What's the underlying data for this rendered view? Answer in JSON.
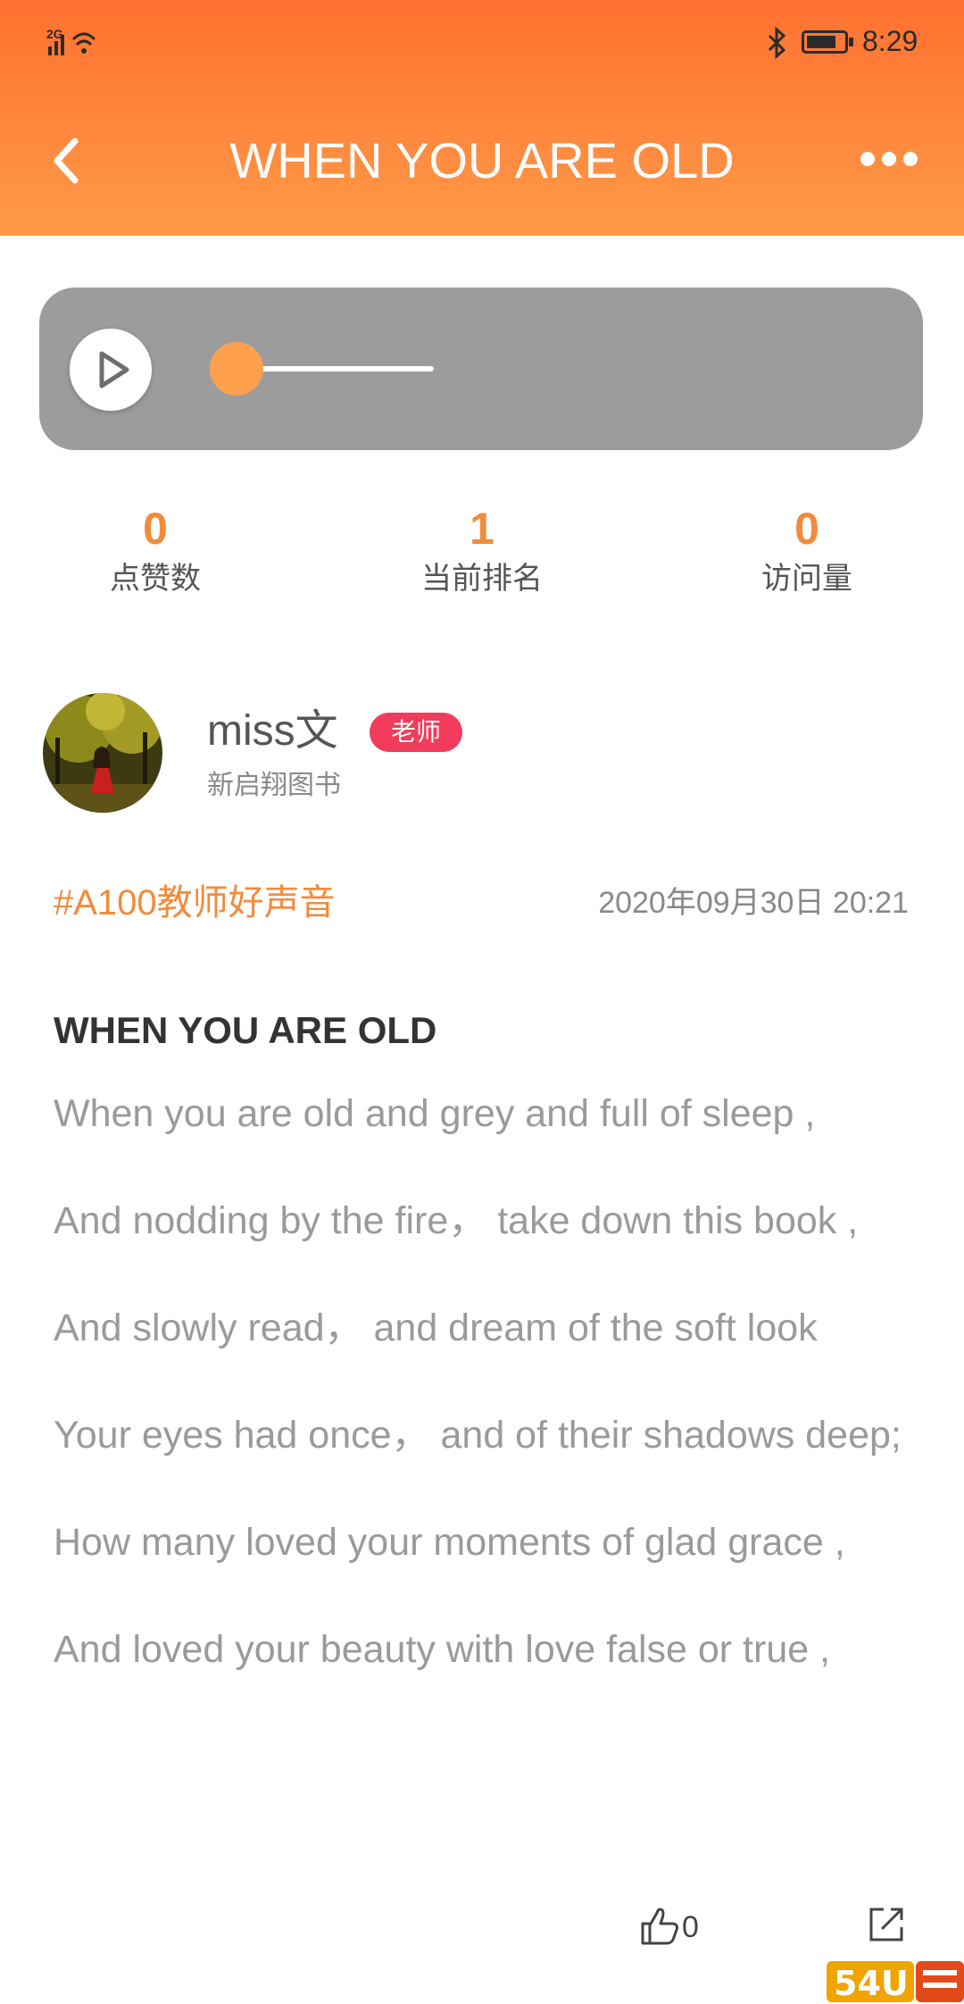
{
  "status_bar": {
    "network": "2G",
    "time": "8:29",
    "battery_level": 0.8
  },
  "header": {
    "title": "WHEN YOU ARE OLD",
    "back_icon": "chevron-left-icon",
    "more_icon": "more-dots-icon"
  },
  "player": {
    "progress": 0.0
  },
  "stats": [
    {
      "value": "0",
      "label": "点赞数"
    },
    {
      "value": "1",
      "label": "当前排名"
    },
    {
      "value": "0",
      "label": "访问量"
    }
  ],
  "author": {
    "name": "miss文",
    "badge": "老师",
    "org": "新启翔图书"
  },
  "post": {
    "tag": "#A100教师好声音",
    "date": "2020年09月30日 20:21",
    "title": "WHEN YOU ARE OLD",
    "lines": [
      "When you are old and grey and full of sleep ,",
      "And nodding by the fire， take down this book ,",
      "And slowly read， and dream of the soft look",
      "Your eyes had once， and of their shadows deep;",
      "How many loved your moments of glad grace ,",
      "And loved your beauty with love false or true ,"
    ]
  },
  "actions": {
    "like_count": "0",
    "like_icon": "thumbs-up-icon",
    "share_icon": "share-icon"
  },
  "watermark": "54U"
}
